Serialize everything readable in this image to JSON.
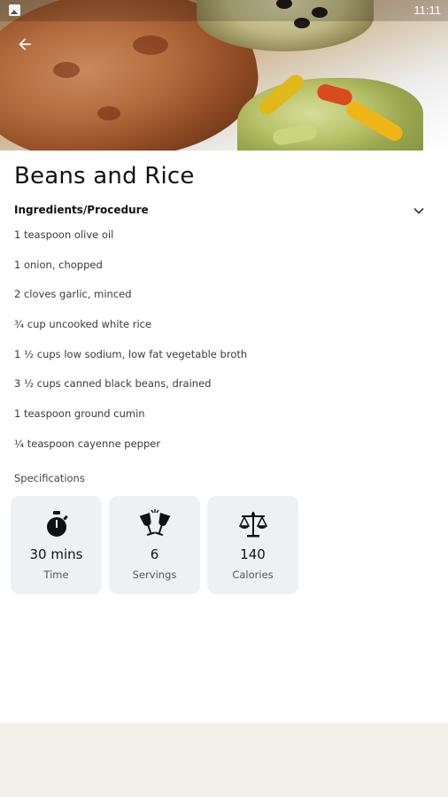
{
  "status_bar": {
    "time": "11:11",
    "icon": "image-notification-icon"
  },
  "nav": {
    "back_icon": "arrow-left-icon"
  },
  "recipe": {
    "title": "Beans and Rice",
    "section_title": "Ingredients/Procedure",
    "ingredients": [
      "1 teaspoon olive oil",
      "1 onion, chopped",
      "2 cloves garlic, minced",
      "¾ cup uncooked white rice",
      "1 ½ cups low sodium, low fat vegetable broth",
      "3 ½ cups canned black beans, drained",
      "1 teaspoon ground cumin",
      "¼ teaspoon cayenne pepper"
    ],
    "specifications_label": "Specifications",
    "specs": [
      {
        "icon": "stopwatch-icon",
        "value": "30 mins",
        "label": "Time"
      },
      {
        "icon": "wine-glasses-icon",
        "value": "6",
        "label": "Servings"
      },
      {
        "icon": "scale-icon",
        "value": "140",
        "label": "Calories"
      }
    ]
  }
}
